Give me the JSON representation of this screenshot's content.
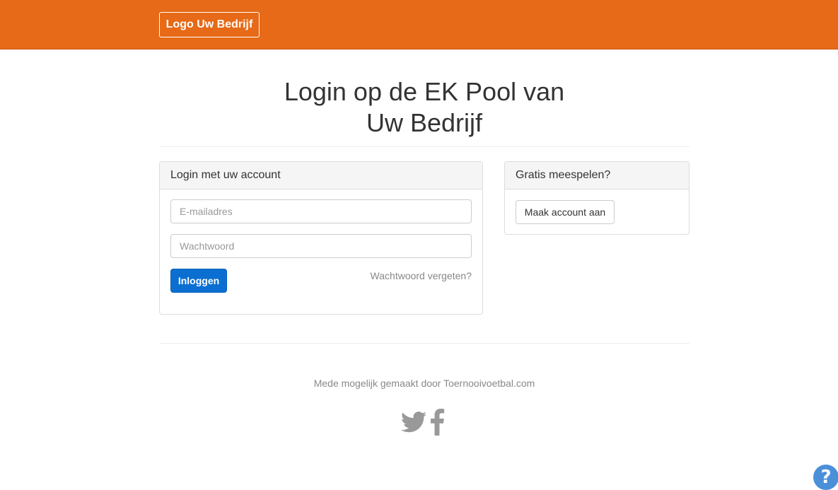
{
  "header": {
    "logo_label": "Logo Uw Bedrijf",
    "background_color": "#e66a17"
  },
  "page": {
    "title_line1": "Login op de EK Pool van",
    "title_line2": "Uw Bedrijf"
  },
  "login_panel": {
    "heading": "Login met uw account",
    "email_placeholder": "E-mailadres",
    "email_value": "",
    "password_placeholder": "Wachtwoord",
    "password_value": "",
    "login_button": "Inloggen",
    "forgot_link": "Wachtwoord vergeten?",
    "accent_color": "#0b6fd2"
  },
  "register_panel": {
    "heading": "Gratis meespelen?",
    "create_button": "Maak account aan"
  },
  "footer": {
    "credit_text": "Mede mogelijk gemaakt door Toernooivoetbal.com",
    "social_icons": [
      "twitter-icon",
      "facebook-icon"
    ]
  },
  "help": {
    "icon": "?"
  }
}
